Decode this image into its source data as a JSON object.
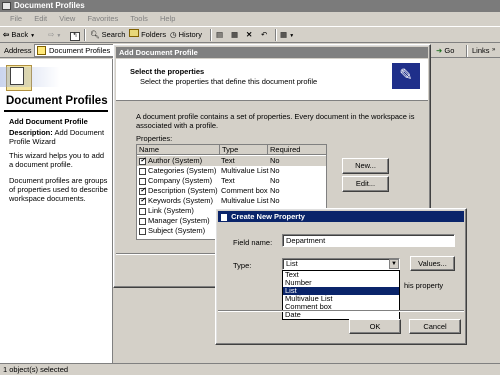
{
  "window": {
    "title": "Document Profiles"
  },
  "menu": [
    "File",
    "Edit",
    "View",
    "Favorites",
    "Tools",
    "Help"
  ],
  "toolbar": {
    "back": "Back",
    "search": "Search",
    "folders": "Folders",
    "history": "History"
  },
  "addressbar": {
    "label": "Address",
    "value": "Document Profiles",
    "go": "Go",
    "links": "Links"
  },
  "leftpane": {
    "title": "Document Profiles",
    "heading": "Add Document Profile",
    "description_label": "Description:",
    "description_value": "Add Document Profile Wizard",
    "para1": "This wizard helps you to add a document profile.",
    "para2": "Document profiles are groups of properties used to describe workspace documents."
  },
  "statusbar": {
    "text": "1 object(s) selected"
  },
  "wizard": {
    "title": "Add Document Profile",
    "header": "Select the properties",
    "subheader": "Select the properties that define this document profile",
    "intro": "A document profile contains a set of properties. Every document in the workspace is associated with a profile.",
    "properties_label": "Properties:",
    "columns": [
      "Name",
      "Type",
      "Required"
    ],
    "rows": [
      {
        "name": "Author (System)",
        "type": "Text",
        "required": "No",
        "checked": true
      },
      {
        "name": "Categories (System)",
        "type": "Multivalue List",
        "required": "No",
        "checked": false
      },
      {
        "name": "Company (System)",
        "type": "Text",
        "required": "No",
        "checked": false
      },
      {
        "name": "Description (System)",
        "type": "Comment box",
        "required": "No",
        "checked": true
      },
      {
        "name": "Keywords (System)",
        "type": "Multivalue List",
        "required": "No",
        "checked": true
      },
      {
        "name": "Link (System)",
        "type": "",
        "required": "",
        "checked": false
      },
      {
        "name": "Manager (System)",
        "type": "",
        "required": "",
        "checked": false
      },
      {
        "name": "Subject (System)",
        "type": "",
        "required": "",
        "checked": false
      }
    ],
    "new_button": "New...",
    "edit_button": "Edit..."
  },
  "property_dialog": {
    "title": "Create New Property",
    "field_name_label": "Field name:",
    "field_name_value": "Department",
    "type_label": "Type:",
    "type_value": "List",
    "values_button": "Values...",
    "options": [
      "Text",
      "Number",
      "List",
      "Multivalue List",
      "Comment box",
      "Date"
    ],
    "selected_option": "List",
    "hidden_text": "his property",
    "ok_button": "OK",
    "cancel_button": "Cancel"
  },
  "colors": {
    "active_title": "#0a246a",
    "inactive_title": "#808080",
    "selection": "#0a246a"
  }
}
